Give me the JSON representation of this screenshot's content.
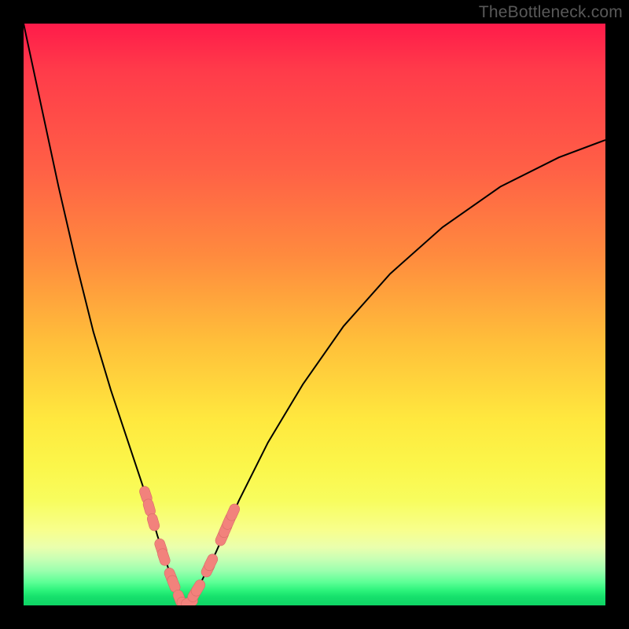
{
  "watermark": {
    "text": "TheBottleneck.com"
  },
  "colors": {
    "frame": "#000000",
    "curve": "#000000",
    "marker_fill": "#f2827c",
    "marker_stroke": "#d76c66",
    "gradient_top": "#ff1b4a",
    "gradient_bottom": "#0fd465"
  },
  "chart_data": {
    "type": "line",
    "title": "",
    "xlabel": "",
    "ylabel": "",
    "xlim": [
      0,
      100
    ],
    "ylim": [
      0,
      100
    ],
    "grid": false,
    "note": "V-shaped bottleneck curve; x is normalized component balance (minimum ≈ optimal match), y is bottleneck severity (0 = none).",
    "series": [
      {
        "name": "bottleneck-curve",
        "x": [
          0,
          3,
          6,
          9,
          12,
          15,
          18,
          21,
          23,
          25,
          27,
          27.5,
          28.5,
          30,
          33,
          37,
          42,
          48,
          55,
          63,
          72,
          82,
          92,
          100
        ],
        "y": [
          100,
          86,
          72,
          59,
          47,
          37,
          28,
          19,
          12,
          6,
          1,
          0,
          0.5,
          3,
          9,
          18,
          28,
          38,
          48,
          57,
          65,
          72,
          77,
          80
        ]
      }
    ],
    "markers": {
      "name": "highlighted-range",
      "note": "Pink pill markers near trough on both branches",
      "points": [
        {
          "x": 21.0,
          "y": 19.0
        },
        {
          "x": 21.6,
          "y": 16.8
        },
        {
          "x": 22.3,
          "y": 14.3
        },
        {
          "x": 23.6,
          "y": 10.0
        },
        {
          "x": 24.1,
          "y": 8.3
        },
        {
          "x": 25.3,
          "y": 5.0
        },
        {
          "x": 25.8,
          "y": 3.7
        },
        {
          "x": 26.8,
          "y": 1.2
        },
        {
          "x": 27.5,
          "y": 0.0
        },
        {
          "x": 28.5,
          "y": 0.5
        },
        {
          "x": 29.4,
          "y": 2.0
        },
        {
          "x": 30.0,
          "y": 3.0
        },
        {
          "x": 31.7,
          "y": 6.3
        },
        {
          "x": 32.2,
          "y": 7.4
        },
        {
          "x": 34.1,
          "y": 11.7
        },
        {
          "x": 34.7,
          "y": 13.1
        },
        {
          "x": 35.3,
          "y": 14.5
        },
        {
          "x": 36.0,
          "y": 16.0
        }
      ]
    }
  }
}
